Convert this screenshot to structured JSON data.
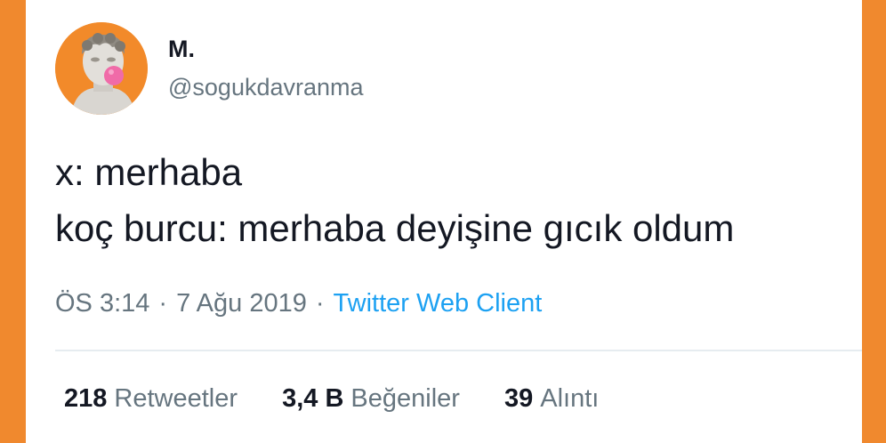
{
  "colors": {
    "background": "#F0892E",
    "card": "#FFFFFF",
    "text_primary": "#141823",
    "text_secondary": "#66757F",
    "link": "#1DA1F2"
  },
  "user": {
    "avatar_icon": "statue-bubblegum-avatar-icon",
    "display_name": "M.",
    "handle": "@sogukdavranma"
  },
  "tweet": {
    "lines": [
      "x: merhaba",
      "koç burcu: merhaba deyişine gıcık oldum"
    ],
    "time": "ÖS 3:14",
    "separator": "·",
    "date": "7 Ağu 2019",
    "client": "Twitter Web Client"
  },
  "stats": {
    "retweets": {
      "count": "218",
      "label": "Retweetler"
    },
    "likes": {
      "count": "3,4 B",
      "label": "Beğeniler"
    },
    "quotes": {
      "count": "39",
      "label": "Alıntı"
    }
  }
}
